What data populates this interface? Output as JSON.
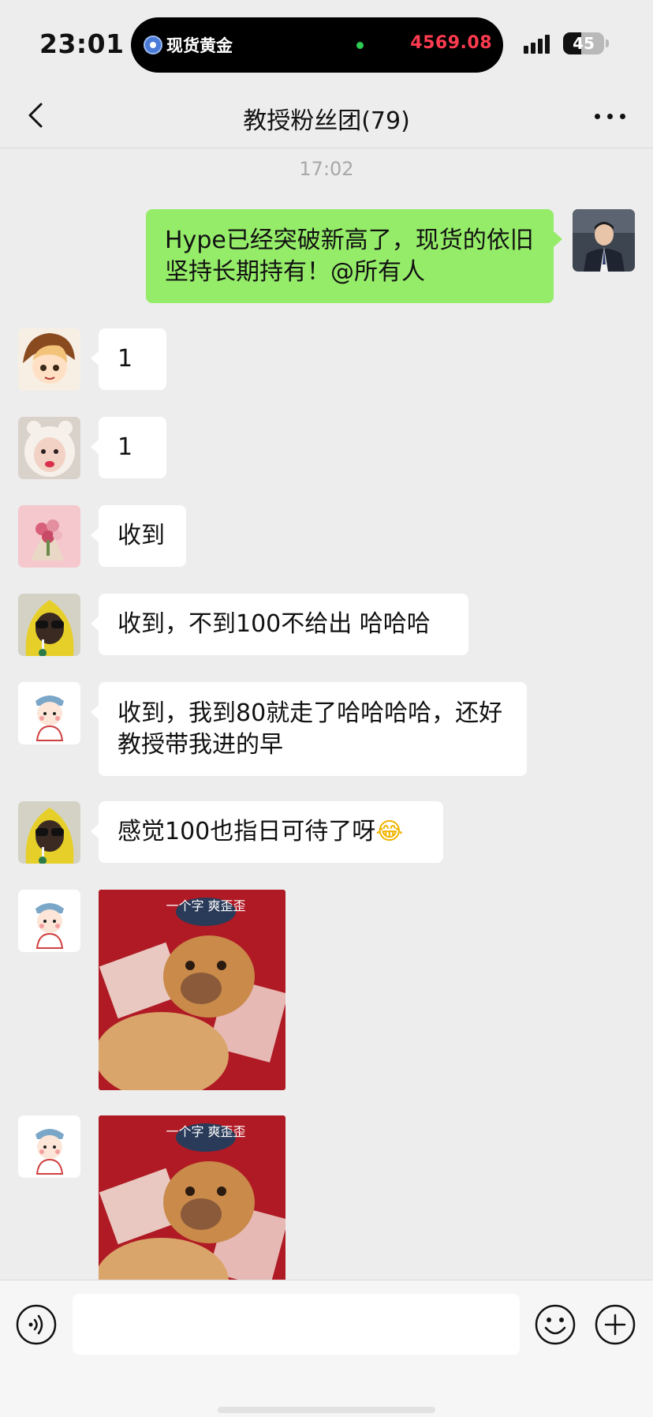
{
  "status_bar": {
    "time": "23:01",
    "island_label": "现货黄金",
    "island_price": "4569.08",
    "battery_level": "45",
    "battery_fraction": 0.45
  },
  "nav": {
    "title": "教授粉丝团(79)"
  },
  "chat": {
    "timestamp": "17:02",
    "messages": [
      {
        "sender": "me",
        "text": "Hype已经突破新高了，现货的依旧坚持长期持有！@所有人"
      },
      {
        "sender": "member-1",
        "text": "1"
      },
      {
        "sender": "member-2",
        "text": "1"
      },
      {
        "sender": "member-3",
        "text": "收到"
      },
      {
        "sender": "member-4",
        "text": "收到，不到100不给出 哈哈哈"
      },
      {
        "sender": "member-5",
        "text": "收到，我到80就走了哈哈哈哈，还好教授带我进的早"
      },
      {
        "sender": "member-4",
        "text": "感觉100也指日可待了呀",
        "emoji": "😂"
      },
      {
        "sender": "member-5",
        "sticker_caption": "一个字 爽歪歪"
      },
      {
        "sender": "member-5",
        "sticker_caption": "一个字 爽歪歪"
      }
    ]
  },
  "input_bar": {
    "value": "",
    "icons": [
      "voice-icon",
      "emoji-icon",
      "plus-icon"
    ]
  },
  "colors": {
    "background": "#ededed",
    "my_bubble": "#95ec69",
    "other_bubble": "#ffffff",
    "price_red": "#ff3b50"
  }
}
